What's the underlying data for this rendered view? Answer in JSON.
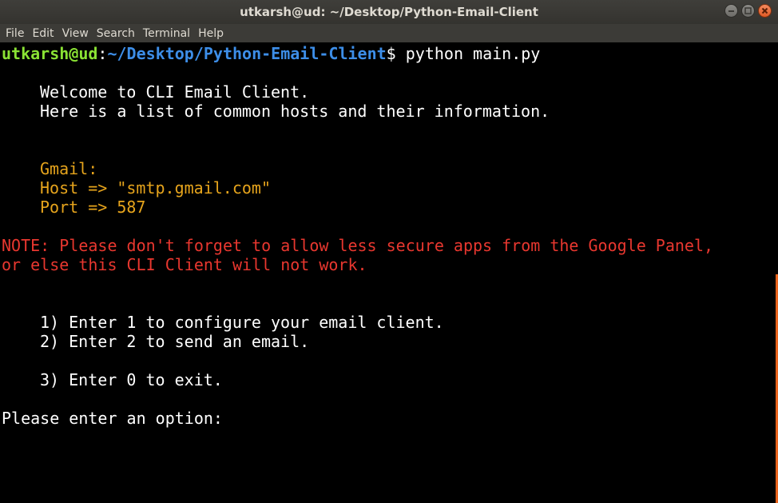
{
  "window": {
    "title": "utkarsh@ud: ~/Desktop/Python-Email-Client"
  },
  "menu": {
    "items": [
      "File",
      "Edit",
      "View",
      "Search",
      "Terminal",
      "Help"
    ]
  },
  "terminal": {
    "prompt_user": "utkarsh@ud",
    "prompt_colon": ":",
    "prompt_path": "~/Desktop/Python-Email-Client",
    "prompt_symbol": "$ ",
    "command": "python main.py",
    "welcome": "Welcome to CLI Email Client.",
    "hosts_intro": "Here is a list of common hosts and their information.",
    "gmail_label": "Gmail:",
    "gmail_host": "Host => \"smtp.gmail.com\"",
    "gmail_port": "Port => 587",
    "note_line1": "NOTE: Please don't forget to allow less secure apps from the Google Panel,",
    "note_line2": "or else this CLI Client will not work.",
    "option1": "1) Enter 1 to configure your email client.",
    "option2": "2) Enter 2 to send an email.",
    "option3": "3) Enter 0 to exit.",
    "input_prompt": "Please enter an option:"
  },
  "colors": {
    "prompt_user": "#8ae234",
    "prompt_path": "#3d8ee8",
    "gmail_info": "#e6a41c",
    "note": "#e8372f",
    "text": "#ffffff",
    "background": "#000000"
  }
}
